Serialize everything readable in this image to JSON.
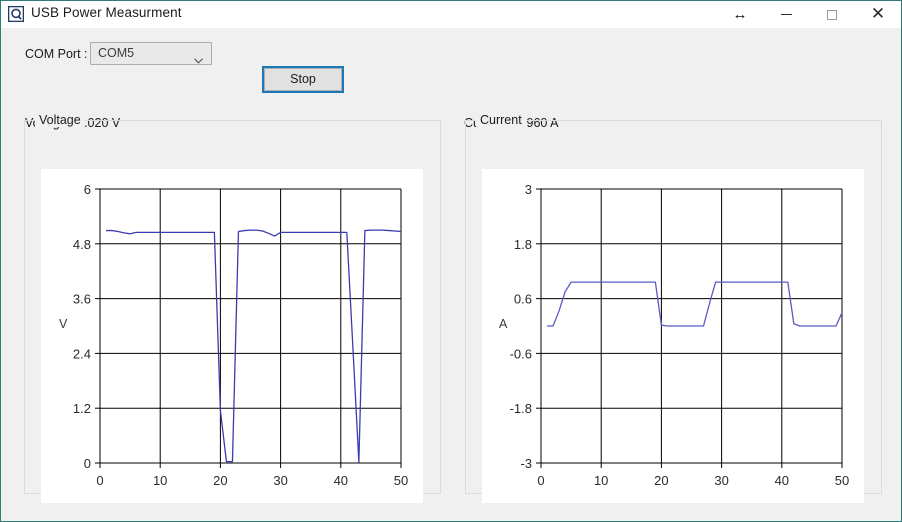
{
  "window": {
    "title": "USB Power Measurment",
    "icon": "app-magnifier-icon",
    "border_color": "#2e7d7b",
    "background": "#f0f0f0",
    "buttons": {
      "resize": "↔",
      "minimize": "–",
      "maximize": "□",
      "close": "✕"
    }
  },
  "toolbar": {
    "com_port_label": "COM Port :",
    "com_port_value": "COM5",
    "com_port_options": [
      "COM5"
    ],
    "stop_label": "Stop",
    "stop_focus_color": "#1b79b8"
  },
  "readouts": {
    "voltage": "Voltage : 5.020 V",
    "current": "Current : 0.960 A"
  },
  "groups": {
    "voltage_label": "Voltage",
    "current_label": "Current"
  },
  "chart_data": [
    {
      "type": "line",
      "id": "voltage-chart",
      "title": "Voltage",
      "xlabel": "",
      "ylabel": "V",
      "axis_unit_label": "V",
      "xlim": [
        0,
        50
      ],
      "ylim": [
        0,
        6
      ],
      "xticks": [
        0,
        10,
        20,
        30,
        40,
        50
      ],
      "yticks": [
        0,
        1.2,
        2.4,
        3.6,
        4.8,
        6
      ],
      "xtick_labels": [
        "0",
        "10",
        "20",
        "30",
        "40",
        "50"
      ],
      "ytick_labels": [
        "0",
        "1.2",
        "2.4",
        "3.6",
        "4.8",
        "6"
      ],
      "grid": true,
      "legend": "none",
      "line_color": "#3b3bb0",
      "series": [
        {
          "name": "Voltage",
          "x": [
            1,
            2,
            3,
            4,
            5,
            6,
            7,
            8,
            9,
            10,
            11,
            12,
            13,
            14,
            15,
            16,
            17,
            18,
            19,
            20,
            21,
            22,
            23,
            24,
            25,
            26,
            27,
            28,
            29,
            30,
            31,
            32,
            33,
            34,
            35,
            36,
            37,
            38,
            39,
            40,
            41,
            42,
            43,
            44,
            45,
            46,
            47,
            48,
            49,
            50
          ],
          "y": [
            5.09,
            5.09,
            5.07,
            5.04,
            5.02,
            5.05,
            5.05,
            5.05,
            5.05,
            5.05,
            5.05,
            5.05,
            5.05,
            5.05,
            5.05,
            5.05,
            5.05,
            5.05,
            5.05,
            1.15,
            0.03,
            0.03,
            5.07,
            5.09,
            5.1,
            5.1,
            5.08,
            5.03,
            4.97,
            5.05,
            5.05,
            5.05,
            5.05,
            5.05,
            5.05,
            5.05,
            5.05,
            5.05,
            5.05,
            5.05,
            5.05,
            2.55,
            0.02,
            5.09,
            5.1,
            5.1,
            5.1,
            5.09,
            5.08,
            5.07
          ]
        }
      ]
    },
    {
      "type": "line",
      "id": "current-chart",
      "title": "Current",
      "xlabel": "",
      "ylabel": "A",
      "axis_unit_label": "A",
      "xlim": [
        0,
        50
      ],
      "ylim": [
        -3,
        3
      ],
      "xticks": [
        0,
        10,
        20,
        30,
        40,
        50
      ],
      "yticks": [
        -3,
        -1.8,
        -0.6,
        0.6,
        1.8,
        3
      ],
      "xtick_labels": [
        "0",
        "10",
        "20",
        "30",
        "40",
        "50"
      ],
      "ytick_labels": [
        "-3",
        "-1.8",
        "-0.6",
        "0.6",
        "1.8",
        "3"
      ],
      "grid": true,
      "legend": "none",
      "line_color": "#5a5ac8",
      "series": [
        {
          "name": "Current",
          "x": [
            1,
            2,
            3,
            4,
            5,
            6,
            7,
            8,
            9,
            10,
            11,
            12,
            13,
            14,
            15,
            16,
            17,
            18,
            19,
            20,
            21,
            22,
            23,
            24,
            25,
            26,
            27,
            28,
            29,
            30,
            31,
            32,
            33,
            34,
            35,
            36,
            37,
            38,
            39,
            40,
            41,
            42,
            43,
            44,
            45,
            46,
            47,
            48,
            49,
            50
          ],
          "y": [
            0.0,
            0.0,
            0.33,
            0.75,
            0.96,
            0.96,
            0.96,
            0.96,
            0.96,
            0.96,
            0.96,
            0.96,
            0.96,
            0.96,
            0.96,
            0.96,
            0.96,
            0.96,
            0.96,
            0.02,
            0.0,
            0.0,
            0.0,
            0.0,
            0.0,
            0.0,
            0.0,
            0.5,
            0.96,
            0.96,
            0.96,
            0.96,
            0.96,
            0.96,
            0.96,
            0.96,
            0.96,
            0.96,
            0.96,
            0.96,
            0.96,
            0.05,
            0.0,
            0.0,
            0.0,
            0.0,
            0.0,
            0.0,
            0.0,
            0.29
          ]
        }
      ]
    }
  ]
}
